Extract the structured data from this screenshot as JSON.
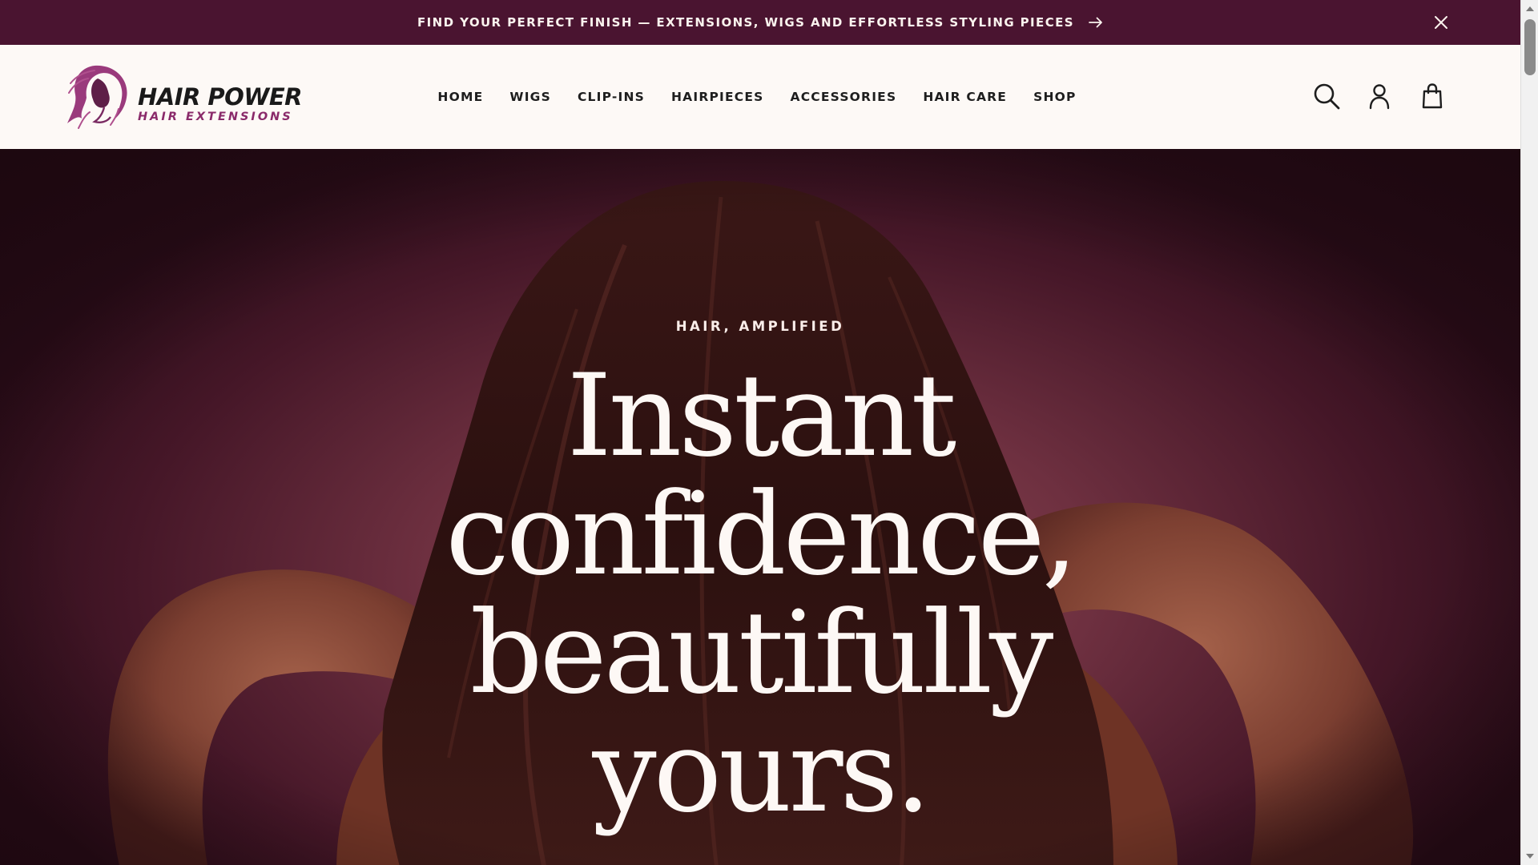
{
  "announcement": {
    "text": "FIND YOUR PERFECT FINISH — EXTENSIONS, WIGS AND EFFORTLESS STYLING PIECES",
    "arrow_icon": "arrow-right-icon",
    "close_icon": "close-icon"
  },
  "header": {
    "logo": {
      "title": "HAIR POWER",
      "subtitle": "HAIR EXTENSIONS"
    },
    "nav": [
      {
        "label": "HOME"
      },
      {
        "label": "WIGS"
      },
      {
        "label": "CLIP-INS"
      },
      {
        "label": "HAIRPIECES"
      },
      {
        "label": "ACCESSORIES"
      },
      {
        "label": "HAIR CARE"
      },
      {
        "label": "SHOP"
      }
    ],
    "icons": [
      "search-icon",
      "account-icon",
      "cart-bag-icon"
    ]
  },
  "hero": {
    "kicker": "HAIR, AMPLIFIED",
    "headline": [
      "Instant",
      "confidence,",
      "beautifully",
      "yours."
    ]
  },
  "colors": {
    "announcement_bg": "#4a1430",
    "header_bg": "#fdf9f6",
    "brand_accent": "#8a2a6a",
    "hero_text": "#fdf8f5"
  }
}
